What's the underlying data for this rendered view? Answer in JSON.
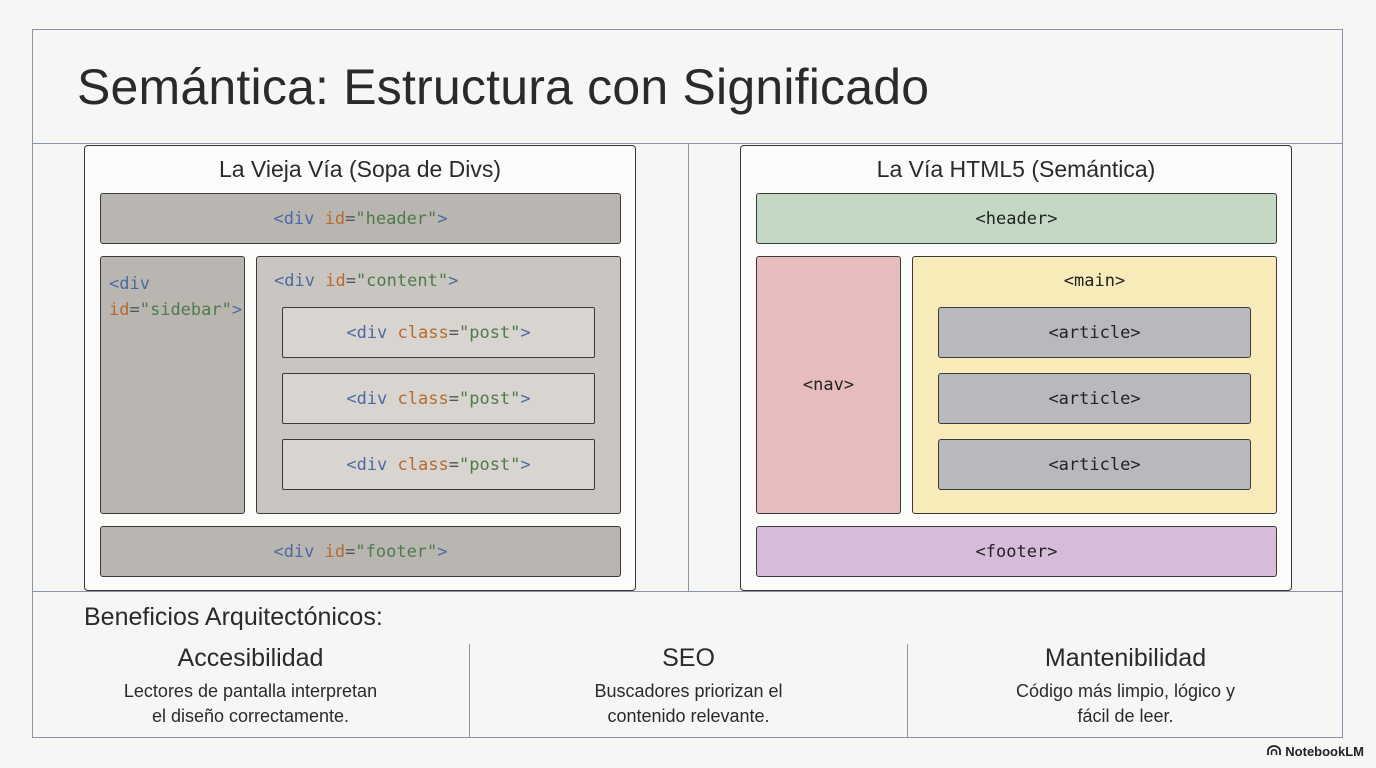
{
  "title": "Semántica: Estructura con Significado",
  "old_way": {
    "title": "La Vieja Vía (Sopa de Divs)",
    "header": {
      "tag": "<div",
      "attr": "id",
      "eq": "=",
      "value": "\"header\"",
      "close": ">"
    },
    "sidebar": {
      "tag": "<div",
      "attr": "id",
      "eq": "=",
      "value": "\"sidebar\"",
      "close": ">"
    },
    "content": {
      "tag": "<div",
      "attr": "id",
      "eq": "=",
      "value": "\"content\"",
      "close": ">"
    },
    "posts": [
      {
        "tag": "<div",
        "attr": "class",
        "eq": "=",
        "value": "\"post\"",
        "close": ">"
      },
      {
        "tag": "<div",
        "attr": "class",
        "eq": "=",
        "value": "\"post\"",
        "close": ">"
      },
      {
        "tag": "<div",
        "attr": "class",
        "eq": "=",
        "value": "\"post\"",
        "close": ">"
      }
    ],
    "footer": {
      "tag": "<div",
      "attr": "id",
      "eq": "=",
      "value": "\"footer\"",
      "close": ">"
    }
  },
  "new_way": {
    "title": "La Vía HTML5 (Semántica)",
    "header": "<header>",
    "nav": "<nav>",
    "main": "<main>",
    "articles": [
      "<article>",
      "<article>",
      "<article>"
    ],
    "footer": "<footer>"
  },
  "benefits": {
    "heading": "Beneficios Arquitectónicos:",
    "items": [
      {
        "title": "Accesibilidad",
        "line1": "Lectores de pantalla interpretan",
        "line2": "el diseño correctamente."
      },
      {
        "title": "SEO",
        "line1": "Buscadores priorizan el",
        "line2": "contenido relevante."
      },
      {
        "title": "Mantenibilidad",
        "line1": "Código más limpio, lógico y",
        "line2": "fácil de leer."
      }
    ]
  },
  "colors": {
    "header": "#c3d9c3",
    "nav": "#e6bcbc",
    "main": "#f7ebb9",
    "article": "#b8b9bd",
    "footer": "#d5bcd9",
    "old_box": "#b9b6b1"
  },
  "brand": "NotebookLM"
}
